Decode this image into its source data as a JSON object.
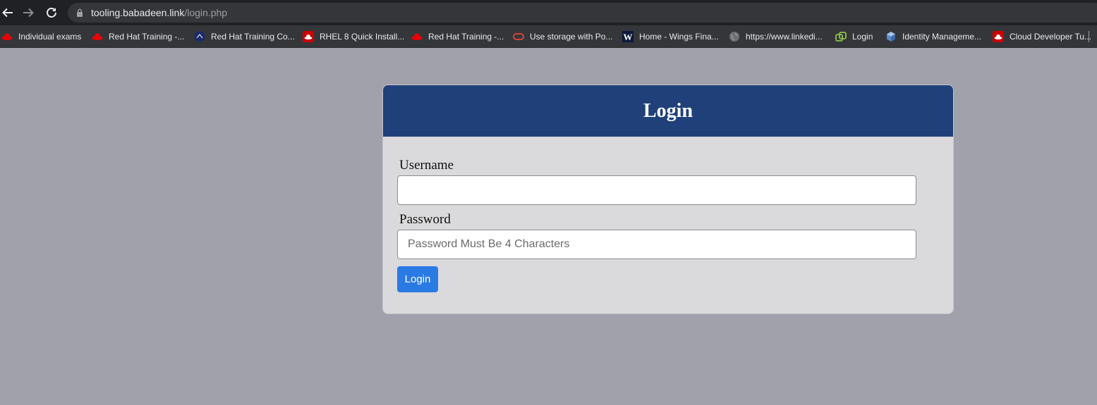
{
  "browser": {
    "url_host": "tooling.babadeen.link",
    "url_path": "/login.php",
    "bookmarks": [
      {
        "label": "Individual exams",
        "icon": "redhat-icon"
      },
      {
        "label": "Red Hat Training -...",
        "icon": "redhat-icon"
      },
      {
        "label": "Red Hat Training Co...",
        "icon": "training-logo-icon"
      },
      {
        "label": "RHEL 8 Quick Install...",
        "icon": "redhat-square-icon"
      },
      {
        "label": "Red Hat Training -...",
        "icon": "redhat-icon"
      },
      {
        "label": "Use storage with Po...",
        "icon": "oracle-icon"
      },
      {
        "label": "Home - Wings Fina...",
        "icon": "wikipedia-w-icon"
      },
      {
        "label": "https://www.linkedi...",
        "icon": "globe-icon"
      },
      {
        "label": "Login",
        "icon": "login-logo-icon"
      },
      {
        "label": "Identity Manageme...",
        "icon": "cube-icon"
      },
      {
        "label": "Cloud Developer Tu...",
        "icon": "redhat-square-icon"
      }
    ]
  },
  "login": {
    "title": "Login",
    "username_label": "Username",
    "username_value": "",
    "password_label": "Password",
    "password_placeholder": "Password Must Be 4 Characters",
    "submit_label": "Login"
  },
  "colors": {
    "page_bg": "#a0a1ab",
    "header_bg": "#20407a",
    "card_bg": "#dad9db",
    "button_bg": "#2a7ae4"
  }
}
